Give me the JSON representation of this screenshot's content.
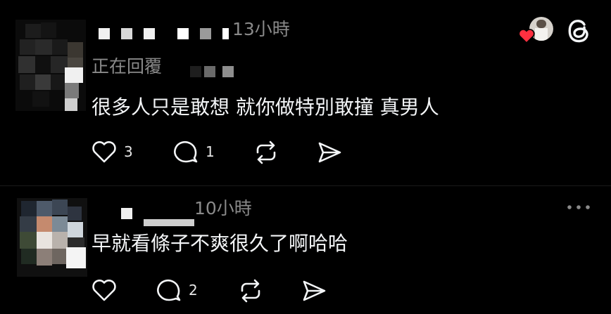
{
  "app": {
    "logo_icon": "threads-logo-icon"
  },
  "colors": {
    "background": "#000000",
    "text": "#f3f5f7",
    "meta": "#8a8a8a",
    "heart": "#ff3040"
  },
  "replies": [
    {
      "username": "",
      "timestamp": "13小時",
      "replying_label": "正在回覆",
      "text": "很多人只是敢想 就你做特別敢撞 真男人",
      "likes": "3",
      "comments": "1",
      "liked_by_author_icon": "heart-icon"
    },
    {
      "username": "",
      "timestamp": "10小時",
      "text": "早就看條子不爽很久了啊哈哈",
      "likes": "",
      "comments": "2",
      "menu_icon": "more-horizontal-icon"
    }
  ]
}
